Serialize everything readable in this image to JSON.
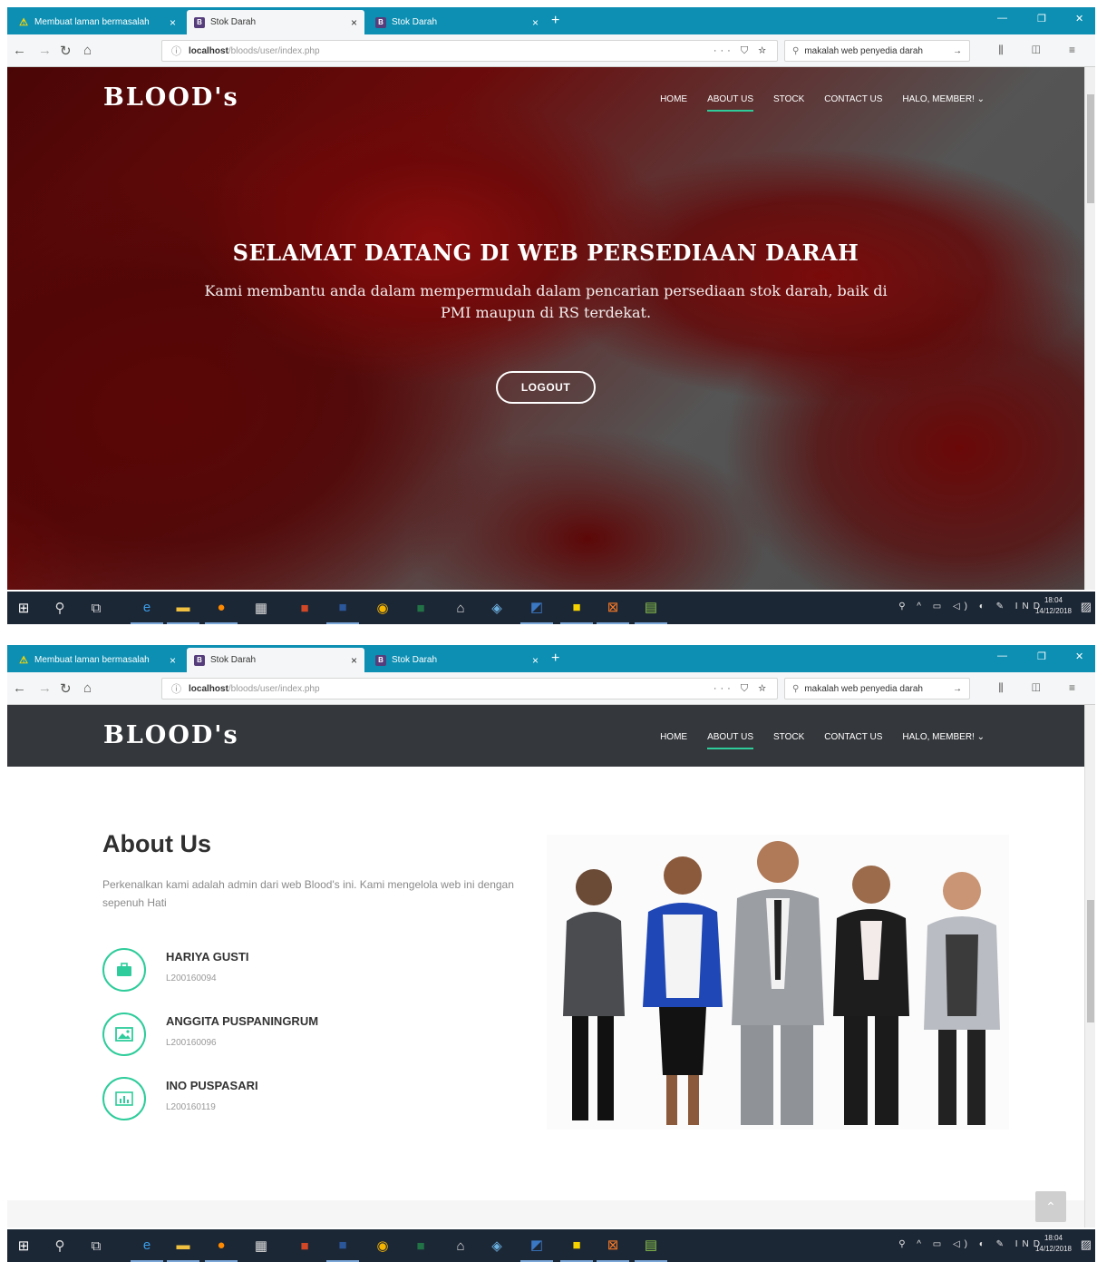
{
  "browser": {
    "tabs": [
      {
        "label": "Membuat laman bermasalah",
        "icon": "warning-icon",
        "active": false
      },
      {
        "label": "Stok Darah",
        "icon": "bootstrap-icon",
        "active": true
      },
      {
        "label": "Stok Darah",
        "icon": "bootstrap-icon",
        "active": false
      }
    ],
    "close_glyph": "×",
    "new_tab_glyph": "+",
    "url_host": "localhost",
    "url_path": "/bloods/user/index.php",
    "page_actions": "··· ⛉ ☆",
    "search_text": "makalah web penyedia darah",
    "search_go": "→"
  },
  "site": {
    "brand": "BLOOD's",
    "menu": [
      "HOME",
      "ABOUT US",
      "STOCK",
      "CONTACT US",
      "HALO, MEMBER! ⌄"
    ],
    "active_menu": "ABOUT US"
  },
  "hero": {
    "title": "SELAMAT DATANG DI WEB PERSEDIAAN DARAH",
    "subtitle": "Kami membantu anda dalam mempermudah dalam pencarian persediaan stok darah, baik di PMI maupun di RS terdekat.",
    "button": "LOGOUT"
  },
  "about": {
    "title": "About Us",
    "description": "Perkenalkan kami adalah admin dari web Blood's ini. Kami mengelola web ini dengan sepenuh Hati",
    "members": [
      {
        "name": "HARIYA GUSTI",
        "id": "L200160094",
        "icon": "briefcase-icon"
      },
      {
        "name": "ANGGITA PUSPANINGRUM",
        "id": "L200160096",
        "icon": "image-icon"
      },
      {
        "name": "INO PUSPASARI",
        "id": "L200160119",
        "icon": "chart-icon"
      }
    ]
  },
  "taskbar": {
    "tray_lang": "IND",
    "time": "18:04",
    "date": "14/12/2018"
  },
  "colors": {
    "browser_accent": "#0c8fb3",
    "site_accent": "#2ecc9a",
    "header_dark": "#34373b",
    "taskbar": "#1c2736"
  }
}
